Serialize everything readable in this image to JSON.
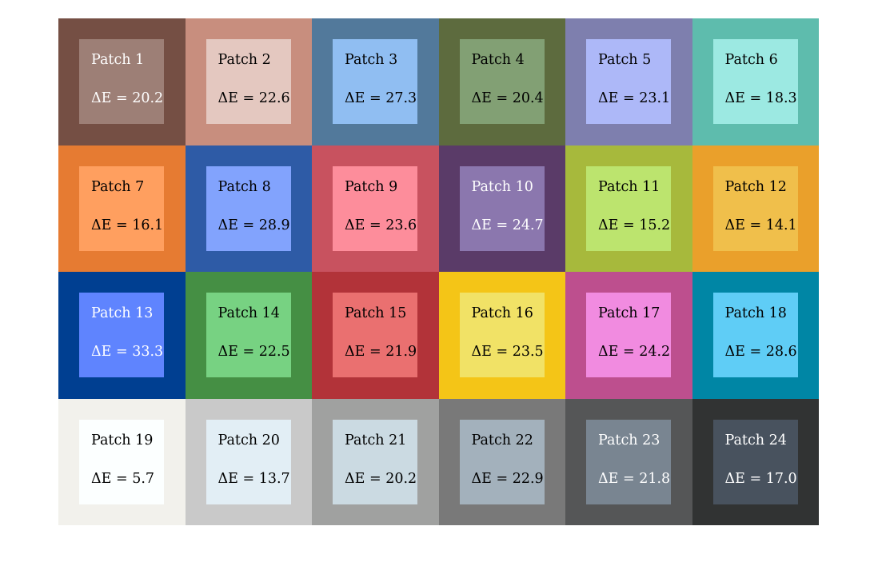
{
  "figure": {
    "title": "",
    "rows": 4,
    "cols": 6
  },
  "patches": [
    {
      "label": "Patch 1",
      "delta_e_text": "ΔE = 20.2",
      "delta_e": 20.2,
      "outer_color": "#754f44",
      "inner_color": "#9d7f76",
      "text_color": "#ffffff"
    },
    {
      "label": "Patch 2",
      "delta_e_text": "ΔE = 22.6",
      "delta_e": 22.6,
      "outer_color": "#c88e7e",
      "inner_color": "#e4c8c0",
      "text_color": "#000000"
    },
    {
      "label": "Patch 3",
      "delta_e_text": "ΔE = 27.3",
      "delta_e": 27.3,
      "outer_color": "#52799b",
      "inner_color": "#90bef2",
      "text_color": "#000000"
    },
    {
      "label": "Patch 4",
      "delta_e_text": "ΔE = 20.4",
      "delta_e": 20.4,
      "outer_color": "#5d6b3e",
      "inner_color": "#82a074",
      "text_color": "#000000"
    },
    {
      "label": "Patch 5",
      "delta_e_text": "ΔE = 23.1",
      "delta_e": 23.1,
      "outer_color": "#7e7fae",
      "inner_color": "#adb8f8",
      "text_color": "#000000"
    },
    {
      "label": "Patch 6",
      "delta_e_text": "ΔE = 18.3",
      "delta_e": 18.3,
      "outer_color": "#5ebcad",
      "inner_color": "#9ce9e2",
      "text_color": "#000000"
    },
    {
      "label": "Patch 7",
      "delta_e_text": "ΔE = 16.1",
      "delta_e": 16.1,
      "outer_color": "#e67b32",
      "inner_color": "#ff9f5f",
      "text_color": "#000000"
    },
    {
      "label": "Patch 8",
      "delta_e_text": "ΔE = 28.9",
      "delta_e": 28.9,
      "outer_color": "#2e5ba6",
      "inner_color": "#82a3fd",
      "text_color": "#000000"
    },
    {
      "label": "Patch 9",
      "delta_e_text": "ΔE = 23.6",
      "delta_e": 23.6,
      "outer_color": "#c8525f",
      "inner_color": "#fd8d9b",
      "text_color": "#000000"
    },
    {
      "label": "Patch 10",
      "delta_e_text": "ΔE = 24.7",
      "delta_e": 24.7,
      "outer_color": "#5a3b68",
      "inner_color": "#8b77ae",
      "text_color": "#ffffff"
    },
    {
      "label": "Patch 11",
      "delta_e_text": "ΔE = 15.2",
      "delta_e": 15.2,
      "outer_color": "#a7b93c",
      "inner_color": "#bce46e",
      "text_color": "#000000"
    },
    {
      "label": "Patch 12",
      "delta_e_text": "ΔE = 14.1",
      "delta_e": 14.1,
      "outer_color": "#eaa02b",
      "inner_color": "#f0bf4b",
      "text_color": "#000000"
    },
    {
      "label": "Patch 13",
      "delta_e_text": "ΔE = 33.3",
      "delta_e": 33.3,
      "outer_color": "#003f91",
      "inner_color": "#5f84fe",
      "text_color": "#ffffff"
    },
    {
      "label": "Patch 14",
      "delta_e_text": "ΔE = 22.5",
      "delta_e": 22.5,
      "outer_color": "#458f44",
      "inner_color": "#77d282",
      "text_color": "#000000"
    },
    {
      "label": "Patch 15",
      "delta_e_text": "ΔE = 21.9",
      "delta_e": 21.9,
      "outer_color": "#b23339",
      "inner_color": "#ea7070",
      "text_color": "#000000"
    },
    {
      "label": "Patch 16",
      "delta_e_text": "ΔE = 23.5",
      "delta_e": 23.5,
      "outer_color": "#f4c517",
      "inner_color": "#f1e266",
      "text_color": "#000000"
    },
    {
      "label": "Patch 17",
      "delta_e_text": "ΔE = 24.2",
      "delta_e": 24.2,
      "outer_color": "#bd4f8e",
      "inner_color": "#f18be0",
      "text_color": "#000000"
    },
    {
      "label": "Patch 18",
      "delta_e_text": "ΔE = 28.6",
      "delta_e": 28.6,
      "outer_color": "#0086a5",
      "inner_color": "#5fcdf6",
      "text_color": "#000000"
    },
    {
      "label": "Patch 19",
      "delta_e_text": "ΔE = 5.7",
      "delta_e": 5.7,
      "outer_color": "#f2f1ec",
      "inner_color": "#fcffff",
      "text_color": "#000000"
    },
    {
      "label": "Patch 20",
      "delta_e_text": "ΔE = 13.7",
      "delta_e": 13.7,
      "outer_color": "#c9c9c9",
      "inner_color": "#e2eef5",
      "text_color": "#000000"
    },
    {
      "label": "Patch 21",
      "delta_e_text": "ΔE = 20.2",
      "delta_e": 20.2,
      "outer_color": "#a0a1a0",
      "inner_color": "#cbdae2",
      "text_color": "#000000"
    },
    {
      "label": "Patch 22",
      "delta_e_text": "ΔE = 22.9",
      "delta_e": 22.9,
      "outer_color": "#797979",
      "inner_color": "#a3b1bc",
      "text_color": "#000000"
    },
    {
      "label": "Patch 23",
      "delta_e_text": "ΔE = 21.8",
      "delta_e": 21.8,
      "outer_color": "#555657",
      "inner_color": "#798591",
      "text_color": "#ffffff"
    },
    {
      "label": "Patch 24",
      "delta_e_text": "ΔE = 17.0",
      "delta_e": 17.0,
      "outer_color": "#313333",
      "inner_color": "#48525e",
      "text_color": "#ffffff"
    }
  ]
}
